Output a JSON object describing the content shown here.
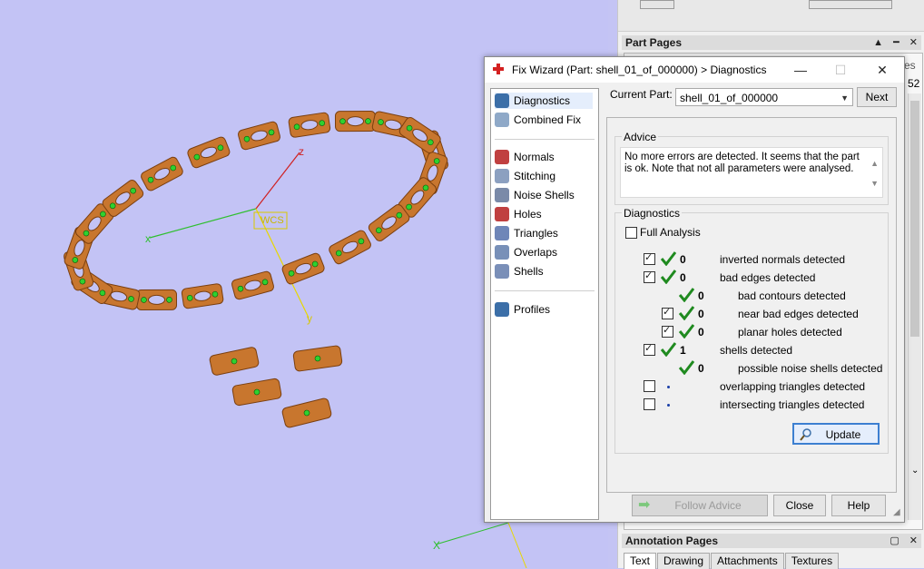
{
  "viewport": {
    "wcs_label": "WCS",
    "axis_x": "x",
    "axis_y": "y",
    "axis_z": "z",
    "axis_x2": "X"
  },
  "right_panel": {
    "part_pages_title": "Part Pages",
    "panel_controls": "▲ ━ ✕",
    "partial_tab": "es",
    "partial_number": "52",
    "annotation_pages_title": "Annotation Pages",
    "annotation_controls": "▢ ✕",
    "tabs": [
      "Text",
      "Drawing",
      "Attachments",
      "Textures"
    ]
  },
  "dialog": {
    "title": "Fix Wizard (Part: shell_01_of_000000) > Diagnostics",
    "window_controls": {
      "minimize": "—",
      "maximize": "☐",
      "close": "✕"
    },
    "sidebar": [
      {
        "label": "Diagnostics",
        "icon": "magnifier-icon",
        "color": "#3c6fa8"
      },
      {
        "label": "Combined Fix",
        "icon": "combined-fix-icon",
        "color": "#8fa9c8"
      },
      {
        "label": "Normals",
        "icon": "normals-cube-icon",
        "color": "#c04040"
      },
      {
        "label": "Stitching",
        "icon": "stitching-cube-icon",
        "color": "#8ca0c0"
      },
      {
        "label": "Noise Shells",
        "icon": "noise-shells-icon",
        "color": "#7a8aa8"
      },
      {
        "label": "Holes",
        "icon": "holes-cube-icon",
        "color": "#c04040"
      },
      {
        "label": "Triangles",
        "icon": "triangles-icon",
        "color": "#6f86b8"
      },
      {
        "label": "Overlaps",
        "icon": "overlaps-icon",
        "color": "#7890b8"
      },
      {
        "label": "Shells",
        "icon": "shells-cube-icon",
        "color": "#7a8fb8"
      },
      {
        "label": "Profiles",
        "icon": "profiles-document-icon",
        "color": "#3c6fa8"
      }
    ],
    "current_part_label": "Current Part:",
    "current_part_value": "shell_01_of_000000",
    "next_label": "Next",
    "advice_title": "Advice",
    "advice_text": "No more errors are detected. It seems that the part is ok. Note that not all parameters were analysed.",
    "diagnostics_title": "Diagnostics",
    "full_analysis_label": "Full Analysis",
    "rows": [
      {
        "checkbox": "checked",
        "tick": true,
        "value": "0",
        "label": "inverted normals detected",
        "level": 0
      },
      {
        "checkbox": "checked",
        "tick": true,
        "value": "0",
        "label": "bad edges detected",
        "level": 0
      },
      {
        "checkbox": "none",
        "tick": true,
        "value": "0",
        "label": "bad contours detected",
        "level": 1
      },
      {
        "checkbox": "checked",
        "tick": true,
        "value": "0",
        "label": "near bad edges detected",
        "level": 1
      },
      {
        "checkbox": "checked",
        "tick": true,
        "value": "0",
        "label": "planar holes detected",
        "level": 1
      },
      {
        "checkbox": "checked",
        "tick": true,
        "value": "1",
        "label": "shells detected",
        "level": 0
      },
      {
        "checkbox": "none",
        "tick": true,
        "value": "0",
        "label": "possible noise shells detected",
        "level": 1
      },
      {
        "checkbox": "unchecked",
        "tick": false,
        "value": "",
        "label": "overlapping triangles detected",
        "level": 0
      },
      {
        "checkbox": "unchecked",
        "tick": false,
        "value": "",
        "label": "intersecting triangles detected",
        "level": 0
      }
    ],
    "update_label": "Update",
    "follow_advice_label": "Follow Advice",
    "close_label": "Close",
    "help_label": "Help"
  },
  "colors": {
    "viewport_bg": "#c3c3f5",
    "bracelet": "#c8762e",
    "marker": "#2fd12f",
    "tick_green": "#1f8a1f"
  }
}
